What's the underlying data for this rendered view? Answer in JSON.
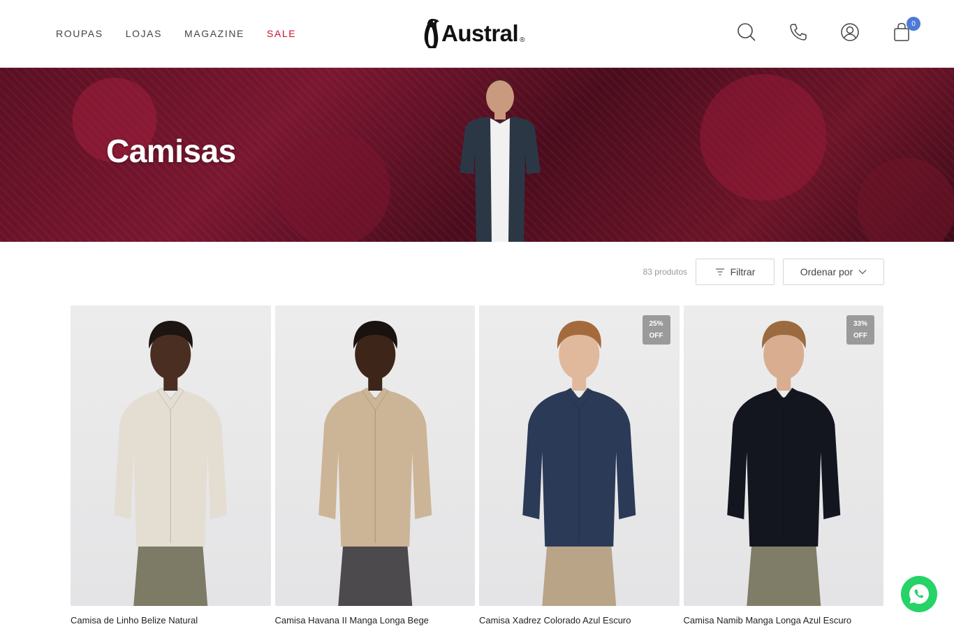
{
  "nav": {
    "items": [
      {
        "label": "ROUPAS"
      },
      {
        "label": "LOJAS"
      },
      {
        "label": "MAGAZINE"
      },
      {
        "label": "SALE"
      }
    ]
  },
  "logo": {
    "text": "Austral",
    "mark": "®"
  },
  "header": {
    "icons": [
      "search-icon",
      "phone-icon",
      "user-icon",
      "bag-icon"
    ],
    "cart_count": "0"
  },
  "hero": {
    "title": "Camisas"
  },
  "toolbar": {
    "count": "83 produtos",
    "filter_label": "Filtrar",
    "order_label": "Ordenar por"
  },
  "products": [
    {
      "name": "Camisa de Linho Belize Natural",
      "badge_line1": "",
      "badge_line2": "",
      "shirt": "#e4ddd2",
      "pants": "#7d7a66",
      "skin": "#4a2e22",
      "hair": "#1c1512"
    },
    {
      "name": "Camisa Havana II Manga Longa Bege",
      "badge_line1": "",
      "badge_line2": "",
      "shirt": "#ccb497",
      "pants": "#4d4a4e",
      "skin": "#3e2519",
      "hair": "#1a120e"
    },
    {
      "name": "Camisa Xadrez Colorado Azul Escuro",
      "badge_line1": "25%",
      "badge_line2": "OFF",
      "shirt": "#2b3a57",
      "pants": "#b9a488",
      "skin": "#e0b89c",
      "hair": "#a56a3c"
    },
    {
      "name": "Camisa Namib Manga Longa Azul Escuro",
      "badge_line1": "33%",
      "badge_line2": "OFF",
      "shirt": "#14161f",
      "pants": "#7f7c67",
      "skin": "#d8ad90",
      "hair": "#9b6a3f"
    }
  ],
  "colors": {
    "accent": "#c8102e",
    "badge": "#4b7bd6",
    "whatsapp": "#25d366"
  }
}
